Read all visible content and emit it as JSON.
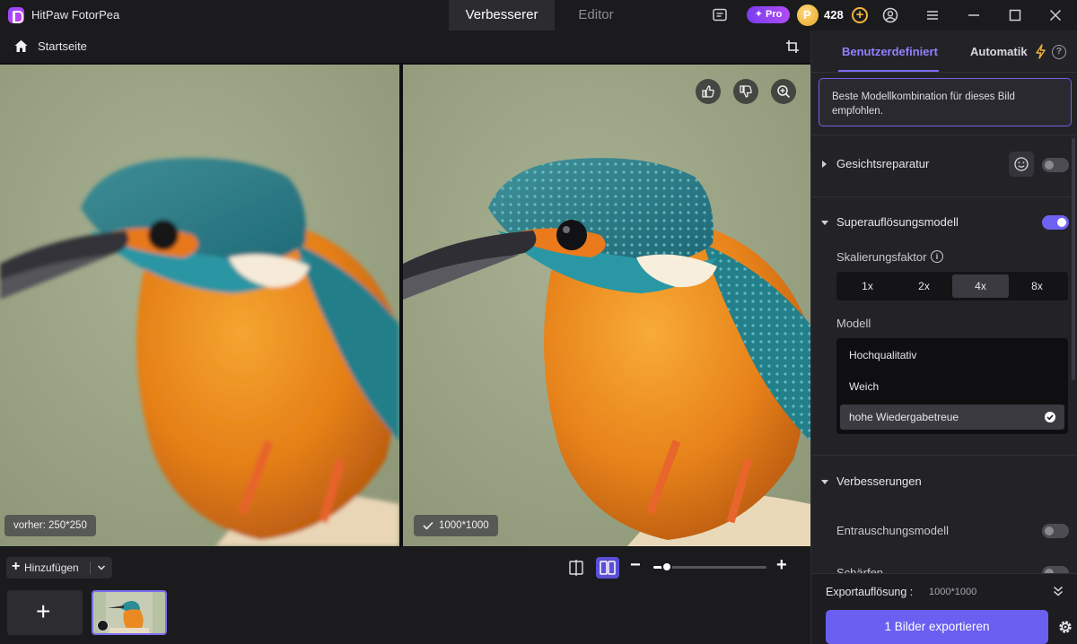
{
  "app": {
    "title": "HitPaw FotorPea"
  },
  "top_tabs": [
    {
      "label": "Verbesserer",
      "active": true
    },
    {
      "label": "Editor",
      "active": false
    }
  ],
  "account": {
    "pro_label": "Pro",
    "coin_count": "428"
  },
  "toolbar": {
    "home_label": "Startseite"
  },
  "canvas": {
    "before_label": "vorher: 250*250",
    "after_label": "1000*1000"
  },
  "bottom": {
    "add_label": "Hinzufügen",
    "zoom_level": 0.12
  },
  "panel": {
    "tabs": [
      {
        "label": "Benutzerdefiniert",
        "active": true
      },
      {
        "label": "Automatik",
        "active": false
      }
    ],
    "hint": "Beste Modellkombination für dieses Bild empfohlen.",
    "face_repair": {
      "label": "Gesichtsreparatur",
      "enabled": false
    },
    "super_resolution": {
      "label": "Superauflösungsmodell",
      "enabled": true,
      "scale_label": "Skalierungsfaktor",
      "scale_options": [
        "1x",
        "2x",
        "4x",
        "8x"
      ],
      "scale_selected": "4x",
      "model_label": "Modell",
      "models": [
        "Hochqualitativ",
        "Weich",
        "hohe Wiedergabetreue"
      ],
      "model_selected": "hohe Wiedergabetreue"
    },
    "enhancements": {
      "label": "Verbesserungen",
      "denoise_label": "Entrauschungsmodell",
      "sharpen_label": "Schärfen"
    },
    "export": {
      "resolution_label": "Exportauflösung :",
      "resolution_value": "1000*1000",
      "button_label": "1 Bilder exportieren"
    }
  },
  "colors": {
    "accent": "#6a5ff0",
    "accent_text": "#8f82ff",
    "coin": "#f0b43a"
  }
}
